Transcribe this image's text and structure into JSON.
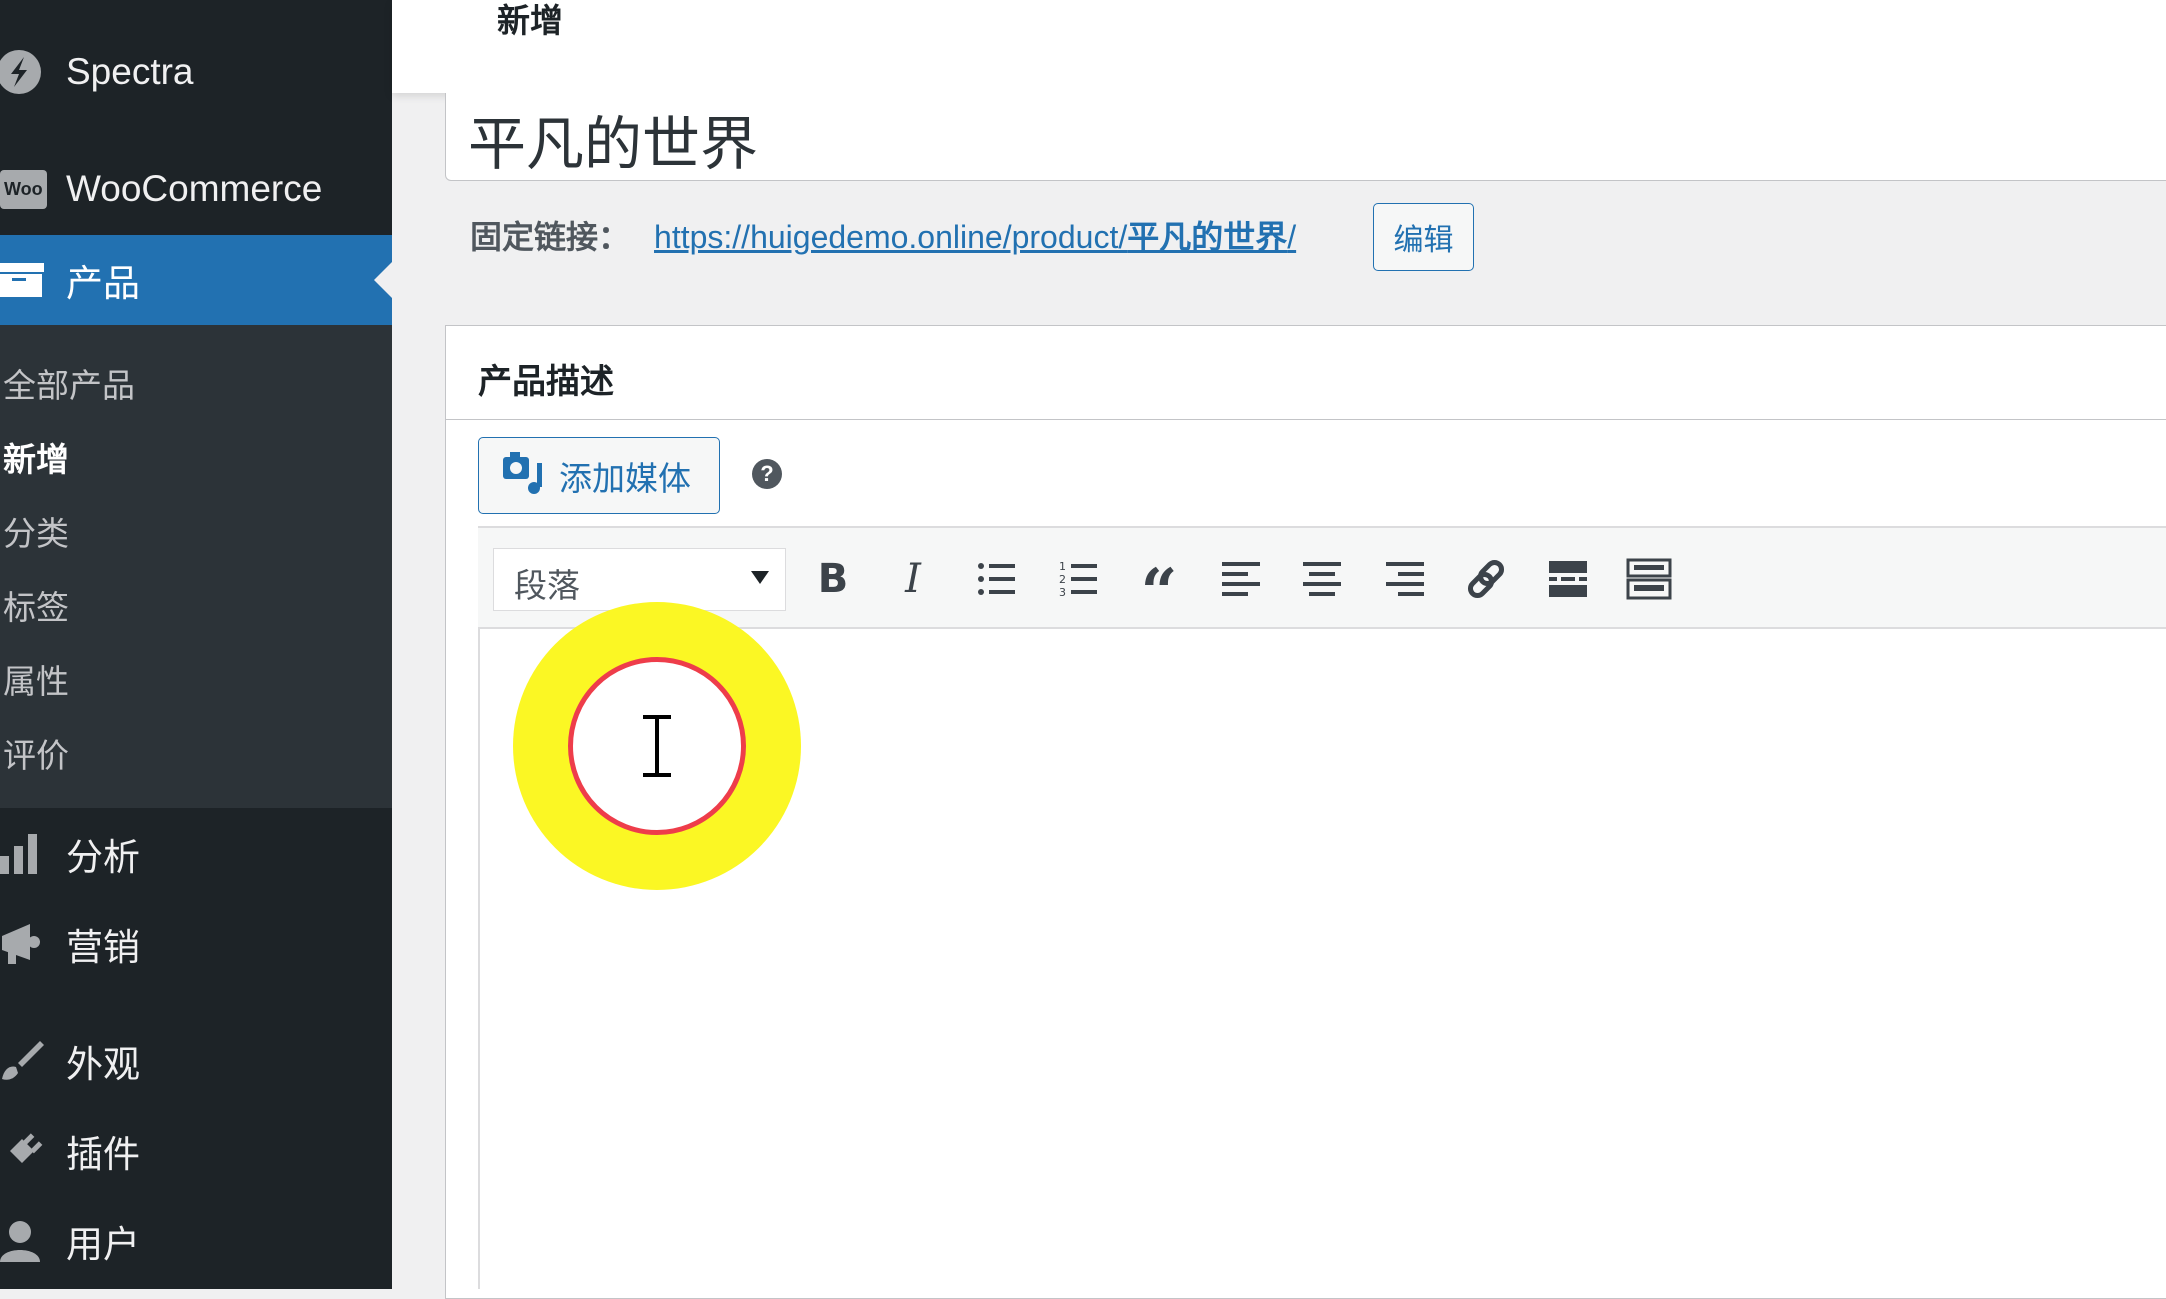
{
  "sidebar": {
    "items": [
      {
        "label": "Spectra",
        "icon": "spectra-icon"
      },
      {
        "label": "WooCommerce",
        "icon": "woo-icon"
      },
      {
        "label": "产品",
        "icon": "archive-icon",
        "current": true
      },
      {
        "label": "分析",
        "icon": "chart-bar-icon"
      },
      {
        "label": "营销",
        "icon": "megaphone-icon"
      },
      {
        "label": "外观",
        "icon": "paintbrush-icon"
      },
      {
        "label": "插件",
        "icon": "plugin-icon"
      },
      {
        "label": "用户",
        "icon": "user-icon"
      }
    ],
    "submenu": [
      "全部产品",
      "新增",
      "分类",
      "标签",
      "属性",
      "评价"
    ],
    "submenu_active": "新增",
    "woo_badge": "Woo"
  },
  "header": {
    "title": "新增"
  },
  "post": {
    "title": "平凡的世界",
    "permalink_label": "固定链接：",
    "permalink_base": "https://huigedemo.online/product/",
    "permalink_slug": "平凡的世界",
    "permalink_trail": "/",
    "edit_label": "编辑"
  },
  "description": {
    "heading": "产品描述",
    "add_media": "添加媒体",
    "help": "?",
    "format_value": "段落",
    "toolbar": [
      "bold",
      "italic",
      "bulleted-list",
      "numbered-list",
      "blockquote",
      "align-left",
      "align-center",
      "align-right",
      "link",
      "read-more",
      "toolbar-toggle"
    ]
  },
  "colors": {
    "accent": "#2271b1",
    "sidebar": "#1d2327",
    "highlight_yellow": "#fbf724",
    "highlight_red": "#ee3d4a"
  }
}
